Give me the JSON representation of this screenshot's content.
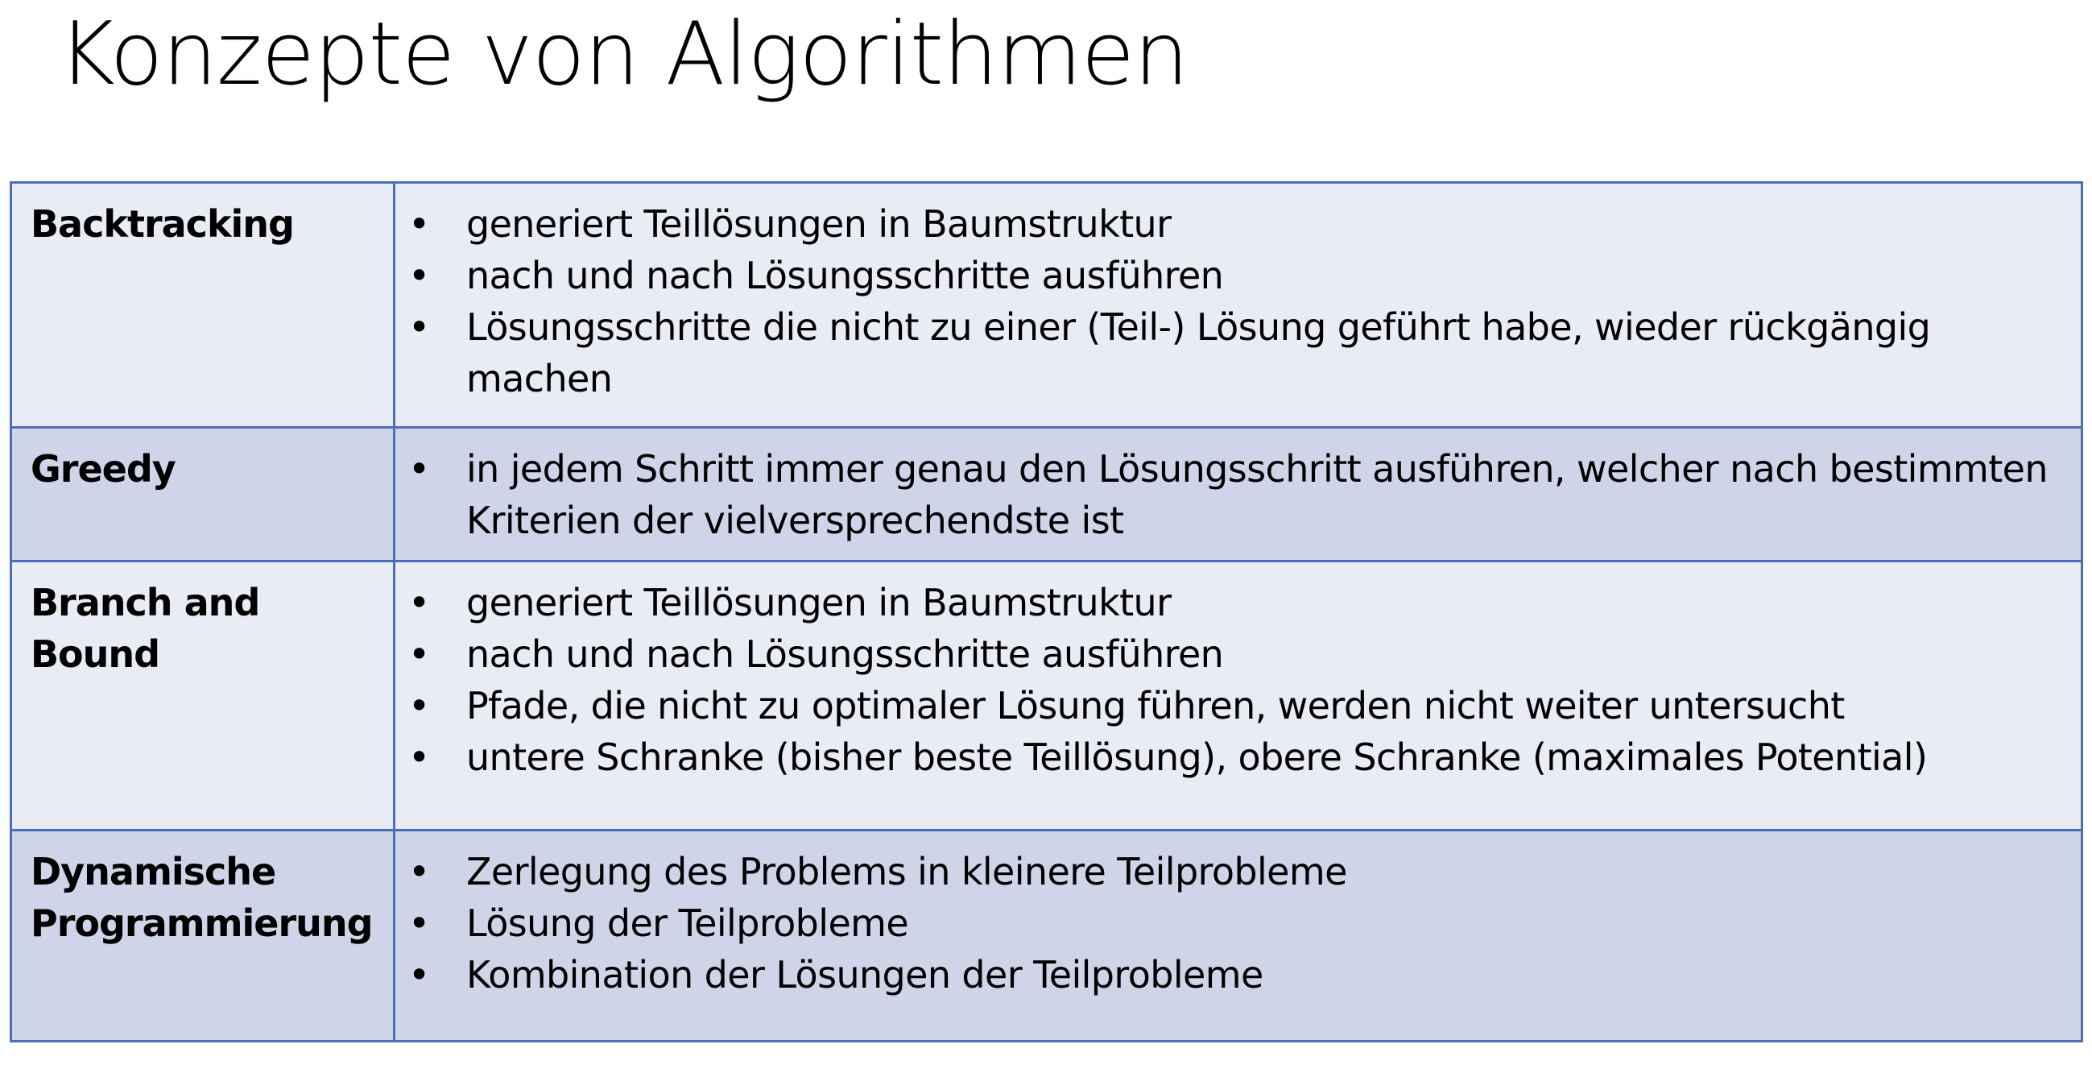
{
  "slide": {
    "title": "Konzepte von Algorithmen"
  },
  "colors": {
    "border": "#4a6fb6",
    "row_light": "#e9ebf5",
    "row_dark": "#cfd4e9"
  },
  "bullet_symbol": "•",
  "concepts": [
    {
      "name": "Backtracking",
      "points": [
        "generiert Teillösungen in Baumstruktur",
        "nach und nach Lösungsschritte ausführen",
        "Lösungsschritte die nicht zu einer (Teil-) Lösung geführt habe, wieder rückgängig machen"
      ]
    },
    {
      "name": "Greedy",
      "points": [
        "in jedem Schritt immer genau den Lösungsschritt ausführen, welcher nach bestimmten Kriterien der vielversprechendste ist"
      ]
    },
    {
      "name": "Branch and Bound",
      "points": [
        "generiert Teillösungen in Baumstruktur",
        "nach und nach Lösungsschritte ausführen",
        "Pfade, die nicht zu optimaler Lösung führen, werden nicht weiter untersucht",
        "untere Schranke (bisher beste Teillösung), obere Schranke (maximales Potential)"
      ]
    },
    {
      "name_lines": [
        "Dynamische",
        "Programmierung"
      ],
      "points": [
        "Zerlegung des Problems in kleinere Teilprobleme",
        "Lösung der Teilprobleme",
        "Kombination der Lösungen der Teilprobleme"
      ]
    }
  ]
}
